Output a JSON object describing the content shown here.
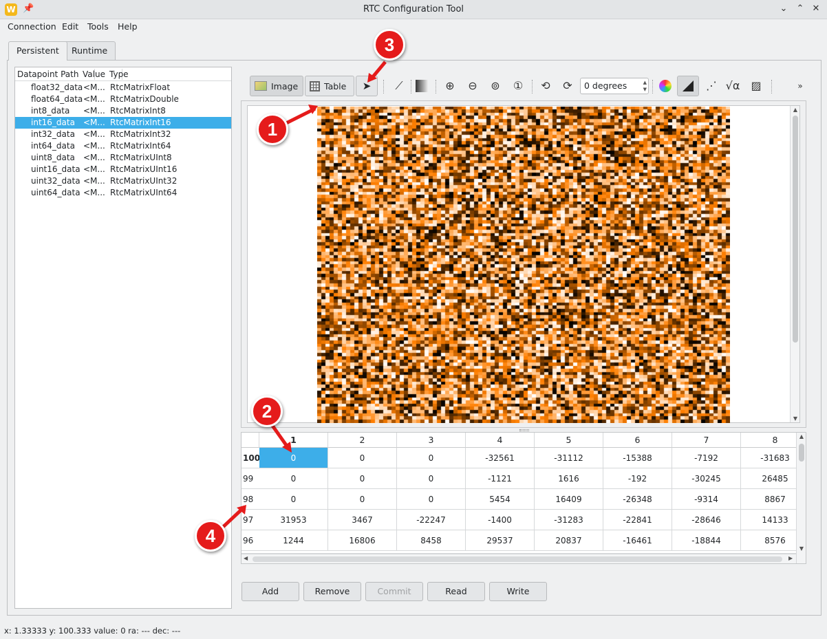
{
  "window": {
    "title": "RTC Configuration Tool",
    "app_icon_letter": "W"
  },
  "menu": {
    "items": [
      {
        "label": "Connection"
      },
      {
        "label": "Edit"
      },
      {
        "label": "Tools"
      },
      {
        "label": "Help"
      }
    ]
  },
  "tabs": [
    {
      "label": "Persistent"
    },
    {
      "label": "Runtime"
    }
  ],
  "tree": {
    "headers": [
      "Datapoint Path",
      "Value",
      "Type"
    ],
    "rows": [
      {
        "path": "float32_data",
        "value": "<M...",
        "type": "RtcMatrixFloat"
      },
      {
        "path": "float64_data",
        "value": "<M...",
        "type": "RtcMatrixDouble"
      },
      {
        "path": "int8_data",
        "value": "<M...",
        "type": "RtcMatrixInt8"
      },
      {
        "path": "int16_data",
        "value": "<M...",
        "type": "RtcMatrixInt16"
      },
      {
        "path": "int32_data",
        "value": "<M...",
        "type": "RtcMatrixInt32"
      },
      {
        "path": "int64_data",
        "value": "<M...",
        "type": "RtcMatrixInt64"
      },
      {
        "path": "uint8_data",
        "value": "<M...",
        "type": "RtcMatrixUInt8"
      },
      {
        "path": "uint16_data",
        "value": "<M...",
        "type": "RtcMatrixUInt16"
      },
      {
        "path": "uint32_data",
        "value": "<M...",
        "type": "RtcMatrixUInt32"
      },
      {
        "path": "uint64_data",
        "value": "<M...",
        "type": "RtcMatrixUInt64"
      }
    ],
    "selected_index": 3
  },
  "toolbar": {
    "image_label": "Image",
    "table_label": "Table",
    "rotation_value": "0 degrees"
  },
  "table": {
    "columns": [
      "1",
      "2",
      "3",
      "4",
      "5",
      "6",
      "7",
      "8"
    ],
    "rows": [
      {
        "label": "100",
        "cells": [
          "0",
          "0",
          "0",
          "-32561",
          "-31112",
          "-15388",
          "-7192",
          "-31683"
        ]
      },
      {
        "label": "99",
        "cells": [
          "0",
          "0",
          "0",
          "-1121",
          "1616",
          "-192",
          "-30245",
          "26485"
        ]
      },
      {
        "label": "98",
        "cells": [
          "0",
          "0",
          "0",
          "5454",
          "16409",
          "-26348",
          "-9314",
          "8867"
        ]
      },
      {
        "label": "97",
        "cells": [
          "31953",
          "3467",
          "-22247",
          "-1400",
          "-31283",
          "-22841",
          "-28646",
          "14133"
        ]
      },
      {
        "label": "96",
        "cells": [
          "1244",
          "16806",
          "8458",
          "29537",
          "20837",
          "-16461",
          "-18844",
          "8576"
        ]
      }
    ],
    "selected_row": 0,
    "selected_col": 0
  },
  "buttons": {
    "add": "Add",
    "remove": "Remove",
    "commit": "Commit",
    "read": "Read",
    "write": "Write"
  },
  "status": "x: 1.33333 y: 100.333 value: 0 ra: --- dec: ---",
  "annotations": [
    "1",
    "2",
    "3",
    "4"
  ],
  "colors": {
    "accent": "#3daee9",
    "badge": "#e51b1b",
    "heatmap_low": "#000000",
    "heatmap_mid": "#ff7f00",
    "heatmap_high": "#ffffff"
  }
}
